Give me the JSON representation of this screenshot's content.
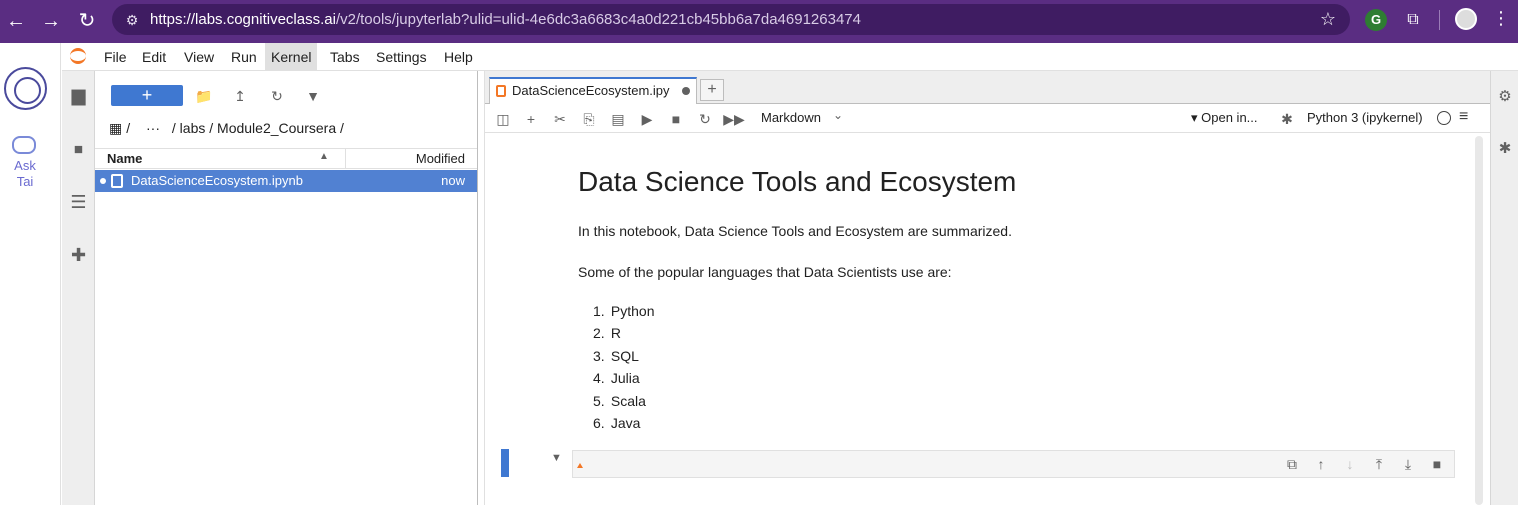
{
  "browser": {
    "url_host": "https://labs.cognitiveclass.ai",
    "url_path": "/v2/tools/jupyterlab?ulid=ulid-4e6dc3a6683c4a0d221cb45bb6a7da4691263474",
    "back_icon": "←",
    "forward_icon": "→",
    "reload_icon": "↻",
    "tune_icon": "⚙",
    "star_icon": "☆",
    "ext_g": "G",
    "puzzle_icon": "⧉",
    "kebab_icon": "⋮"
  },
  "tai": {
    "ask": "Ask",
    "name": "Tai"
  },
  "menu": {
    "items": [
      "File",
      "Edit",
      "View",
      "Run",
      "Kernel",
      "Tabs",
      "Settings",
      "Help"
    ],
    "active": "Kernel"
  },
  "sidebar_icons": {
    "folder": "▆",
    "running": "⏹",
    "toc": "☰",
    "extensions": "✚"
  },
  "filebrowser": {
    "new_label": "+",
    "breadcrumb": {
      "root_sep": "/",
      "ellipsis": "···",
      "path": "/ labs / Module2_Coursera /"
    },
    "columns": {
      "name": "Name",
      "modified": "Modified",
      "sort_icon": "▲"
    },
    "files": [
      {
        "name": "DataScienceEcosystem.ipynb",
        "modified": "now"
      }
    ]
  },
  "notebook": {
    "tab_title": "DataScienceEcosystem.ipy",
    "tab_add": "+",
    "cell_type": "Markdown",
    "open_in": "▾ Open in...",
    "kernel": "Python 3 (ipykernel)",
    "title": "Data Science Tools and Ecosystem",
    "intro": "In this notebook, Data Science Tools and Ecosystem are summarized.",
    "languages_intro": "Some of the popular languages that Data Scientists use are:",
    "languages": [
      "Python",
      "R",
      "SQL",
      "Julia",
      "Scala",
      "Java"
    ]
  },
  "toolbar_icons": {
    "save": "💾",
    "insert": "+",
    "cut": "✂",
    "copy": "⎘",
    "paste": "📋",
    "run": "▶",
    "stop": "■",
    "restart": "↻",
    "run_all": "⏩",
    "debug": "🐞",
    "menu": "≡"
  },
  "cell_tools": {
    "duplicate": "⧉",
    "move_up": "↑",
    "move_down": "↓",
    "insert_above": "⤒",
    "insert_below": "⤓",
    "delete": "🗑"
  },
  "right_icons": {
    "property": "⚙",
    "debugger": "✱"
  }
}
